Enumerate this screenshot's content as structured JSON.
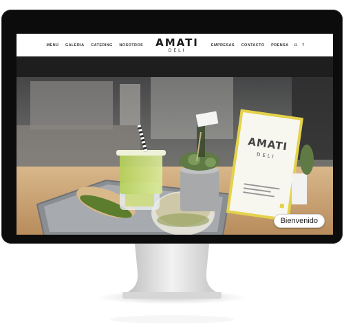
{
  "nav": {
    "left": [
      "MENÚ",
      "GALERIA",
      "CATERING",
      "NOSOTROS"
    ],
    "right": [
      "EMPRESAS",
      "CONTACTO",
      "PRENSA"
    ],
    "social_icons": [
      "instagram-icon",
      "facebook-icon"
    ],
    "facebook_glyph": "f",
    "instagram_glyph": "◘"
  },
  "logo": {
    "main": "AMATI",
    "sub": "DELI"
  },
  "menu_card": {
    "main": "AMATI",
    "sub": "DELI"
  },
  "hero": {
    "button_label": "Bienvenido"
  },
  "colors": {
    "card_border": "#e4d24a",
    "drink": "#c6d96a",
    "tray": "#7e8186"
  }
}
